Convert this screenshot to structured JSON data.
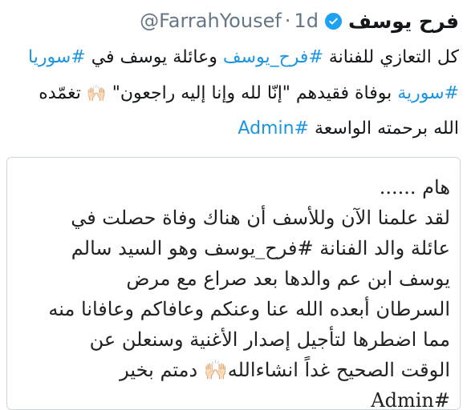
{
  "tweet": {
    "author_name": "فرح يوسف",
    "handle": "@FarrahYousef",
    "separator": "·",
    "time": "1d",
    "text": {
      "part1": "كل التعازي للفنانة ",
      "hashtag1": "#فرح_يوسف",
      "part2": " وعائلة يوسف في ",
      "hashtag2": "#سوريا",
      "part3": " ",
      "hashtag3": "#سورية",
      "part4": " بوفاة فقيدهم \"إنّا لله وإنا إليه راجعون\" ",
      "emoji1": "🙌🏻",
      "part5": " تغمّده الله برحمته الواسعة ",
      "hashtag4": "#Admin"
    }
  },
  "image": {
    "lines": [
      "هام ......",
      "لقد علمنا الآن وللأسف أن هناك وفاة حصلت في",
      "عائلة والد الفنانة #فرح_يوسف وهو السيد سالم",
      "يوسف ابن عم والدها بعد صراع مع مرض",
      "السرطان أبعده الله عنا وعنكم وعافاكم وعافانا منه",
      "مما اضطرها لتأجيل إصدار الأغنية وسنعلن عن",
      "الوقت الصحيح غداً انشاءالله🙌🏻 دمتم بخير",
      "#Admin"
    ]
  },
  "colors": {
    "link": "#1b95e0",
    "muted": "#657786",
    "verified": "#1da1f2",
    "border": "#ccd6dd"
  },
  "icons": {
    "verified": "verified-badge-icon"
  }
}
